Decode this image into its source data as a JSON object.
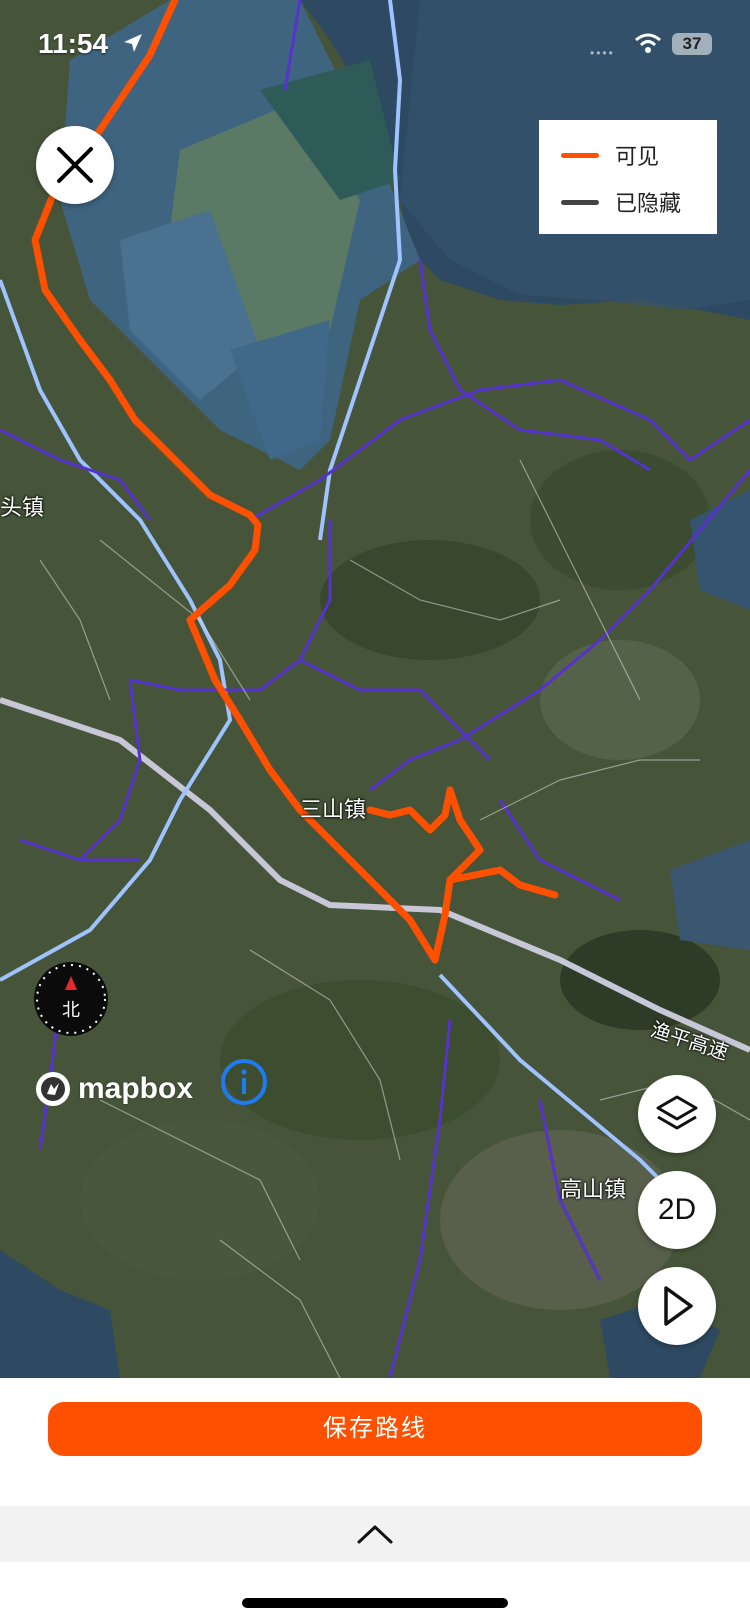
{
  "status_bar": {
    "time": "11:54",
    "battery": "37"
  },
  "legend": {
    "items": [
      {
        "label": "可见",
        "color": "#ff5000"
      },
      {
        "label": "已隐藏",
        "color": "#444444"
      }
    ]
  },
  "map": {
    "labels": {
      "town_left": "头镇",
      "town_sanshan": "三山镇",
      "town_gaoshan": "高山镇",
      "highway": "渔平高速"
    },
    "compass_label": "北",
    "attribution": "mapbox",
    "route_color": "#ff5000",
    "road_color": "#5533cc",
    "highway_color": "#9fc3ff",
    "water_color": "#2c4a66"
  },
  "controls": {
    "close": "close-icon",
    "layers": "layers-icon",
    "mode_toggle": "2D",
    "play": "play-icon",
    "info": "info-icon"
  },
  "footer": {
    "save_label": "保存路线",
    "expand": "chevron-up-icon"
  }
}
